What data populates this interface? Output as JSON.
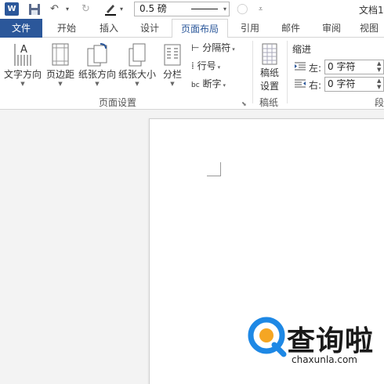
{
  "qat": {
    "logo": "W",
    "line_weight": "0.5 磅",
    "doc_title": "文档1"
  },
  "tabs": [
    "文件",
    "开始",
    "插入",
    "设计",
    "页面布局",
    "引用",
    "邮件",
    "审阅",
    "视图"
  ],
  "active_tab": "页面布局",
  "page_setup": {
    "text_direction": "文字方向",
    "margins": "页边距",
    "orientation": "纸张方向",
    "size": "纸张大小",
    "columns": "分栏",
    "breaks": "分隔符",
    "line_numbers": "行号",
    "hyphenation": "断字",
    "group_label": "页面设置"
  },
  "draft": {
    "button_line1": "稿纸",
    "button_line2": "设置",
    "group_label": "稿纸"
  },
  "indent": {
    "title": "缩进",
    "left_label": "左:",
    "left_value": "0 字符",
    "right_label": "右:",
    "right_value": "0 字符"
  },
  "paragraph_group_partial": "段",
  "watermark": {
    "brand": "查询啦",
    "url": "chaxunla.com"
  },
  "colors": {
    "accent": "#2b579a",
    "watermark_blue": "#1e88e5",
    "watermark_orange": "#f5a623"
  }
}
